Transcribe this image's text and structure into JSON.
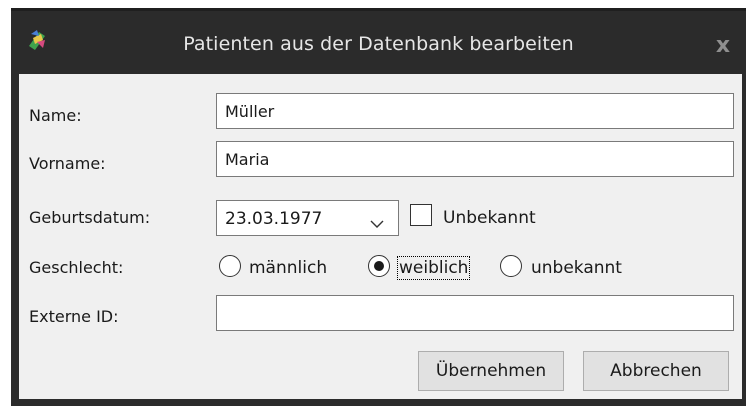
{
  "window": {
    "title": "Patienten aus der Datenbank bearbeiten",
    "close_glyph": "x",
    "app_icon": "app-logo-icon"
  },
  "form": {
    "name_label": "Name:",
    "name_value": "Müller",
    "vorname_label": "Vorname:",
    "vorname_value": "Maria",
    "geburtsdatum_label": "Geburtsdatum:",
    "geburtsdatum_value": "23.03.1977",
    "unbekannt_checkbox_label": "Unbekannt",
    "unbekannt_checked": false,
    "geschlecht_label": "Geschlecht:",
    "gender_options": [
      {
        "label": "männlich",
        "selected": false
      },
      {
        "label": "weiblich",
        "selected": true
      },
      {
        "label": "unbekannt",
        "selected": false
      }
    ],
    "externe_id_label": "Externe ID:",
    "externe_id_value": ""
  },
  "buttons": {
    "apply_label": "Übernehmen",
    "cancel_label": "Abbrechen"
  },
  "colors": {
    "titlebar_bg": "#2b2b2b",
    "content_bg": "#f0f0f0",
    "title_text": "#e6e6e6"
  }
}
